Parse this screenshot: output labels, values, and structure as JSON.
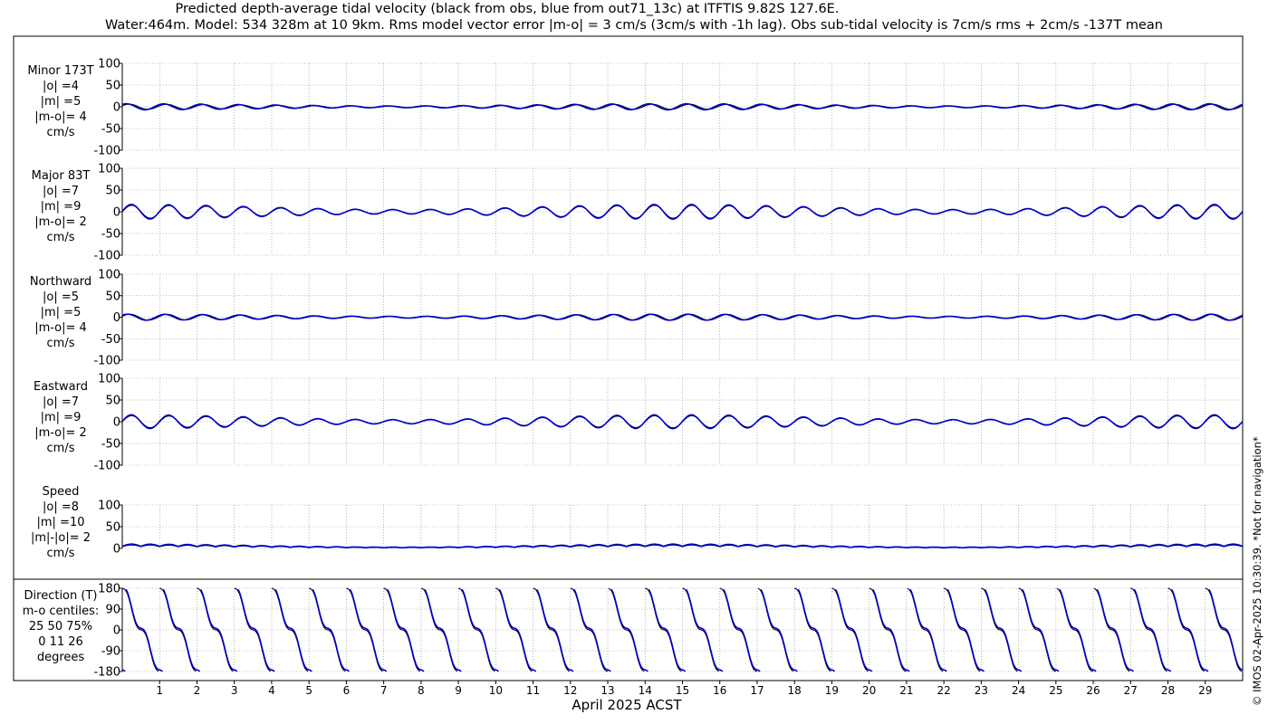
{
  "title_line1": "Predicted depth-average tidal velocity (black from obs, blue from out71_13c) at ITFTIS 9.82S 127.6E.",
  "title_line2": "Water:464m. Model: 534 328m at 10 9km. Rms model vector error |m-o| = 3 cm/s (3cm/s with -1h lag). Obs sub-tidal velocity is 7cm/s rms + 2cm/s -137T mean",
  "side_note": "© IMOS 02-Apr-2025 10:30:39. *Not for navigation*",
  "xlabel": "April 2025 ACST",
  "x_ticks": [
    "1",
    "2",
    "3",
    "4",
    "5",
    "6",
    "7",
    "8",
    "9",
    "10",
    "11",
    "12",
    "13",
    "14",
    "15",
    "16",
    "17",
    "18",
    "19",
    "20",
    "21",
    "22",
    "23",
    "24",
    "25",
    "26",
    "27",
    "28",
    "29"
  ],
  "colors": {
    "obs": "#000000",
    "model": "#0000cc",
    "grid": "#888888"
  },
  "chart_data": [
    {
      "type": "line",
      "panel": "minor",
      "label_lines": [
        "Minor 173T",
        "|o| =4",
        "|m| =5",
        "|m-o|= 4",
        "cm/s"
      ],
      "ylim": [
        -100,
        100
      ],
      "y_ticks": [
        "100",
        "50",
        "0",
        "-50",
        "-100"
      ],
      "x_range_days": [
        0,
        30
      ],
      "series": [
        {
          "color": "black",
          "amplitude": 6,
          "period_days": 1.0,
          "phase": 0.4
        },
        {
          "color": "blue",
          "amplitude": 7,
          "period_days": 1.0,
          "phase": 0.9
        }
      ]
    },
    {
      "type": "line",
      "panel": "major",
      "label_lines": [
        "Major 83T",
        "|o| =7",
        "|m| =9",
        "|m-o|= 2",
        "cm/s"
      ],
      "ylim": [
        -100,
        100
      ],
      "y_ticks": [
        "100",
        "50",
        "0",
        "-50",
        "-100"
      ],
      "x_range_days": [
        0,
        30
      ],
      "series": [
        {
          "color": "black",
          "amplitude": 15,
          "period_days": 1.0,
          "phase": 0.0
        },
        {
          "color": "blue",
          "amplitude": 17,
          "period_days": 1.0,
          "phase": 0.05
        }
      ]
    },
    {
      "type": "line",
      "panel": "northward",
      "label_lines": [
        "Northward",
        "|o| =5",
        "|m| =5",
        "|m-o|= 4",
        "cm/s"
      ],
      "ylim": [
        -100,
        100
      ],
      "y_ticks": [
        "100",
        "50",
        "0",
        "-50",
        "-100"
      ],
      "x_range_days": [
        0,
        30
      ],
      "series": [
        {
          "color": "black",
          "amplitude": 7,
          "period_days": 1.0,
          "phase": 0.3
        },
        {
          "color": "blue",
          "amplitude": 7,
          "period_days": 1.0,
          "phase": 0.7
        }
      ]
    },
    {
      "type": "line",
      "panel": "eastward",
      "label_lines": [
        "Eastward",
        "|o| =7",
        "|m| =9",
        "|m-o|= 2",
        "cm/s"
      ],
      "ylim": [
        -100,
        100
      ],
      "y_ticks": [
        "100",
        "50",
        "0",
        "-50",
        "-100"
      ],
      "x_range_days": [
        0,
        30
      ],
      "series": [
        {
          "color": "black",
          "amplitude": 14,
          "period_days": 1.0,
          "phase": 0.0
        },
        {
          "color": "blue",
          "amplitude": 16,
          "period_days": 1.0,
          "phase": 0.05
        }
      ]
    },
    {
      "type": "line",
      "panel": "speed",
      "label_lines": [
        "Speed",
        "|o| =8",
        "|m| =10",
        "|m|-|o|= 2",
        "cm/s"
      ],
      "ylim": [
        0,
        100
      ],
      "y_ticks": [
        "100",
        "50",
        "0"
      ],
      "x_range_days": [
        0,
        30
      ],
      "series": [
        {
          "color": "black",
          "amplitude": 8,
          "period_days": 1.0,
          "phase": 0.0
        },
        {
          "color": "blue",
          "amplitude": 10,
          "period_days": 1.0,
          "phase": 0.05
        }
      ]
    },
    {
      "type": "line",
      "panel": "direction",
      "label_lines": [
        "Direction (T)",
        "m-o centiles:",
        "25  50  75%",
        "0  11  26",
        "degrees"
      ],
      "ylim": [
        -180,
        180
      ],
      "y_ticks": [
        "180",
        "90",
        "0",
        "-90",
        "-180"
      ],
      "x_range_days": [
        0,
        30
      ],
      "series": [
        {
          "color": "black",
          "kind": "direction",
          "period_days": 1.0
        },
        {
          "color": "blue",
          "kind": "direction",
          "period_days": 1.0
        }
      ]
    }
  ]
}
